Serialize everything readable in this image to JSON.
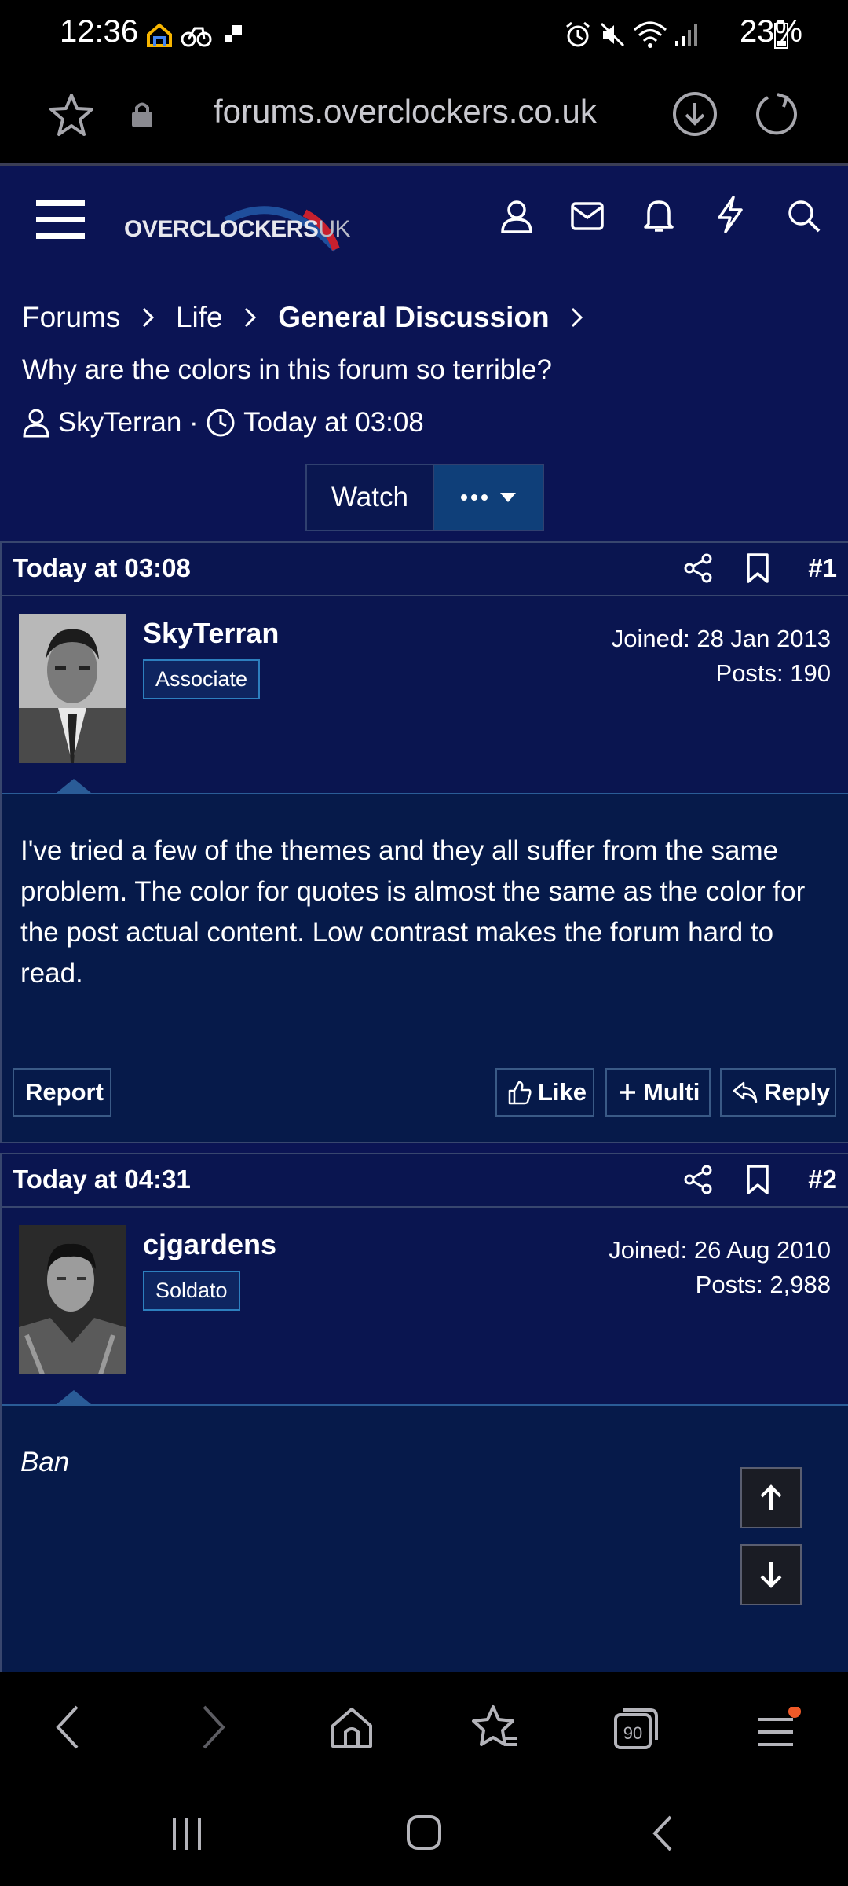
{
  "status_bar": {
    "time": "12:36",
    "battery": "23%"
  },
  "browser": {
    "url": "forums.overclockers.co.uk"
  },
  "site": {
    "logo_main": "OVERCLOCKERS",
    "logo_suffix": "UK",
    "breadcrumbs": [
      "Forums",
      "Life",
      "General Discussion"
    ],
    "thread_title": "Why are the colors in this forum so terrible?",
    "author": "SkyTerran",
    "date": "Today at 03:08",
    "watch_label": "Watch"
  },
  "posts": [
    {
      "date": "Today at 03:08",
      "number": "#1",
      "username": "SkyTerran",
      "badge": "Associate",
      "joined": "Joined: 28 Jan 2013",
      "posts": "Posts: 190",
      "content": "I've tried a few of the themes and they all suffer from the same problem. The color for quotes is almost the same as the color for the post actual content. Low contrast makes the forum hard to read.",
      "report": "Report",
      "like": "Like",
      "multi": "Multi",
      "reply": "Reply"
    },
    {
      "date": "Today at 04:31",
      "number": "#2",
      "username": "cjgardens",
      "badge": "Soldato",
      "joined": "Joined: 26 Aug 2010",
      "posts": "Posts: 2,988",
      "content": "Ban"
    }
  ],
  "bottom_nav": {
    "tabs_count": "90"
  },
  "colors": {
    "site_bg": "#0b1454",
    "post_body_bg": "#061a4a",
    "accent": "#2d7fbe"
  }
}
